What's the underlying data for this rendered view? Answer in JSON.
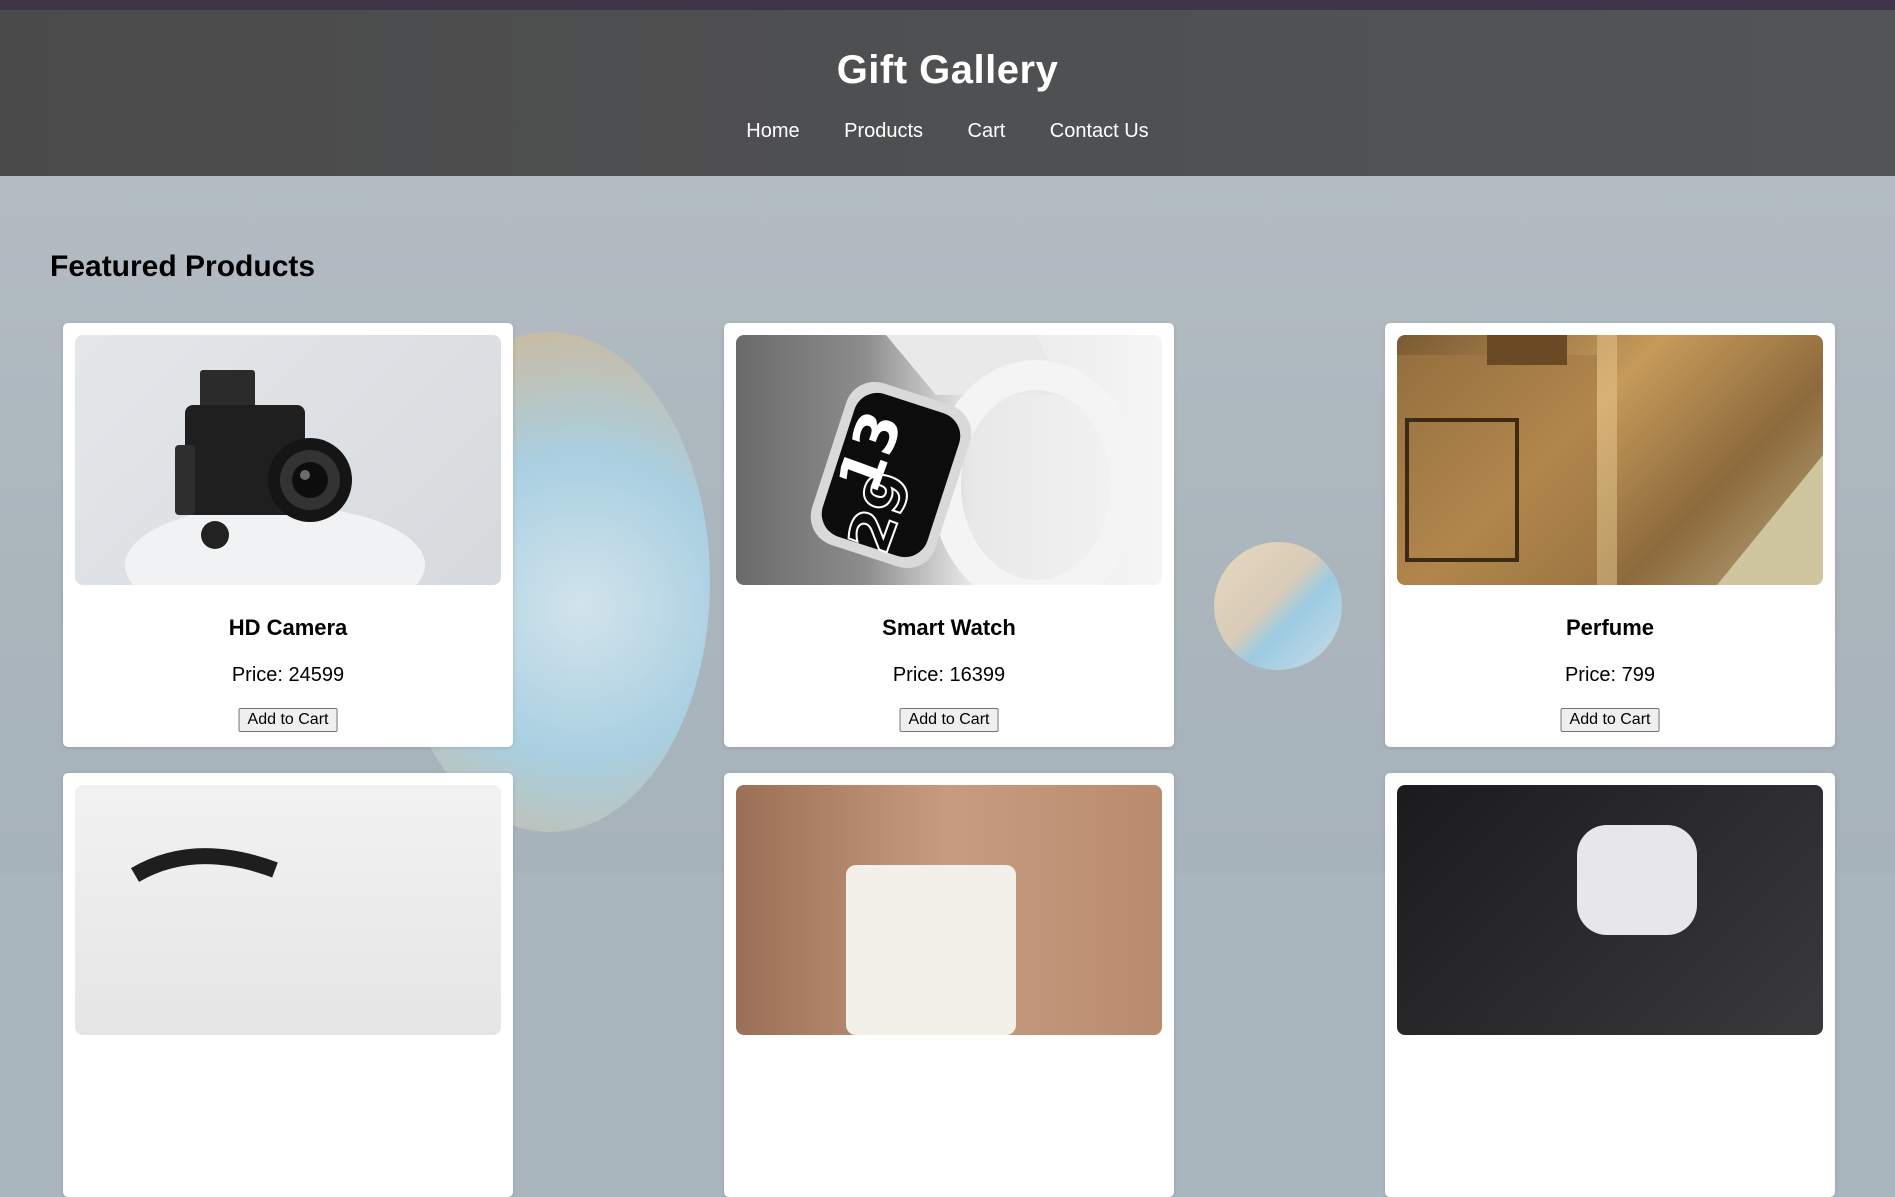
{
  "header": {
    "title": "Gift Gallery",
    "nav": [
      "Home",
      "Products",
      "Cart",
      "Contact Us"
    ]
  },
  "featured": {
    "title": "Featured Products",
    "products": [
      {
        "name": "HD Camera",
        "price_label": "Price: 24599",
        "button": "Add to Cart",
        "image_icon": "camera-image"
      },
      {
        "name": "Smart Watch",
        "price_label": "Price: 16399",
        "button": "Add to Cart",
        "image_icon": "smartwatch-image"
      },
      {
        "name": "Perfume",
        "price_label": "Price: 799",
        "button": "Add to Cart",
        "image_icon": "perfume-image"
      },
      {
        "name": "",
        "price_label": "",
        "button": "",
        "image_icon": "headphones-image"
      },
      {
        "name": "",
        "price_label": "",
        "button": "",
        "image_icon": "mug-image"
      },
      {
        "name": "",
        "price_label": "",
        "button": "",
        "image_icon": "airpods-image"
      }
    ]
  },
  "colors": {
    "top_strip": "#3d3548",
    "header_bg": "#4f5052",
    "page_bg": "#aab6be",
    "card_bg": "#ffffff"
  }
}
